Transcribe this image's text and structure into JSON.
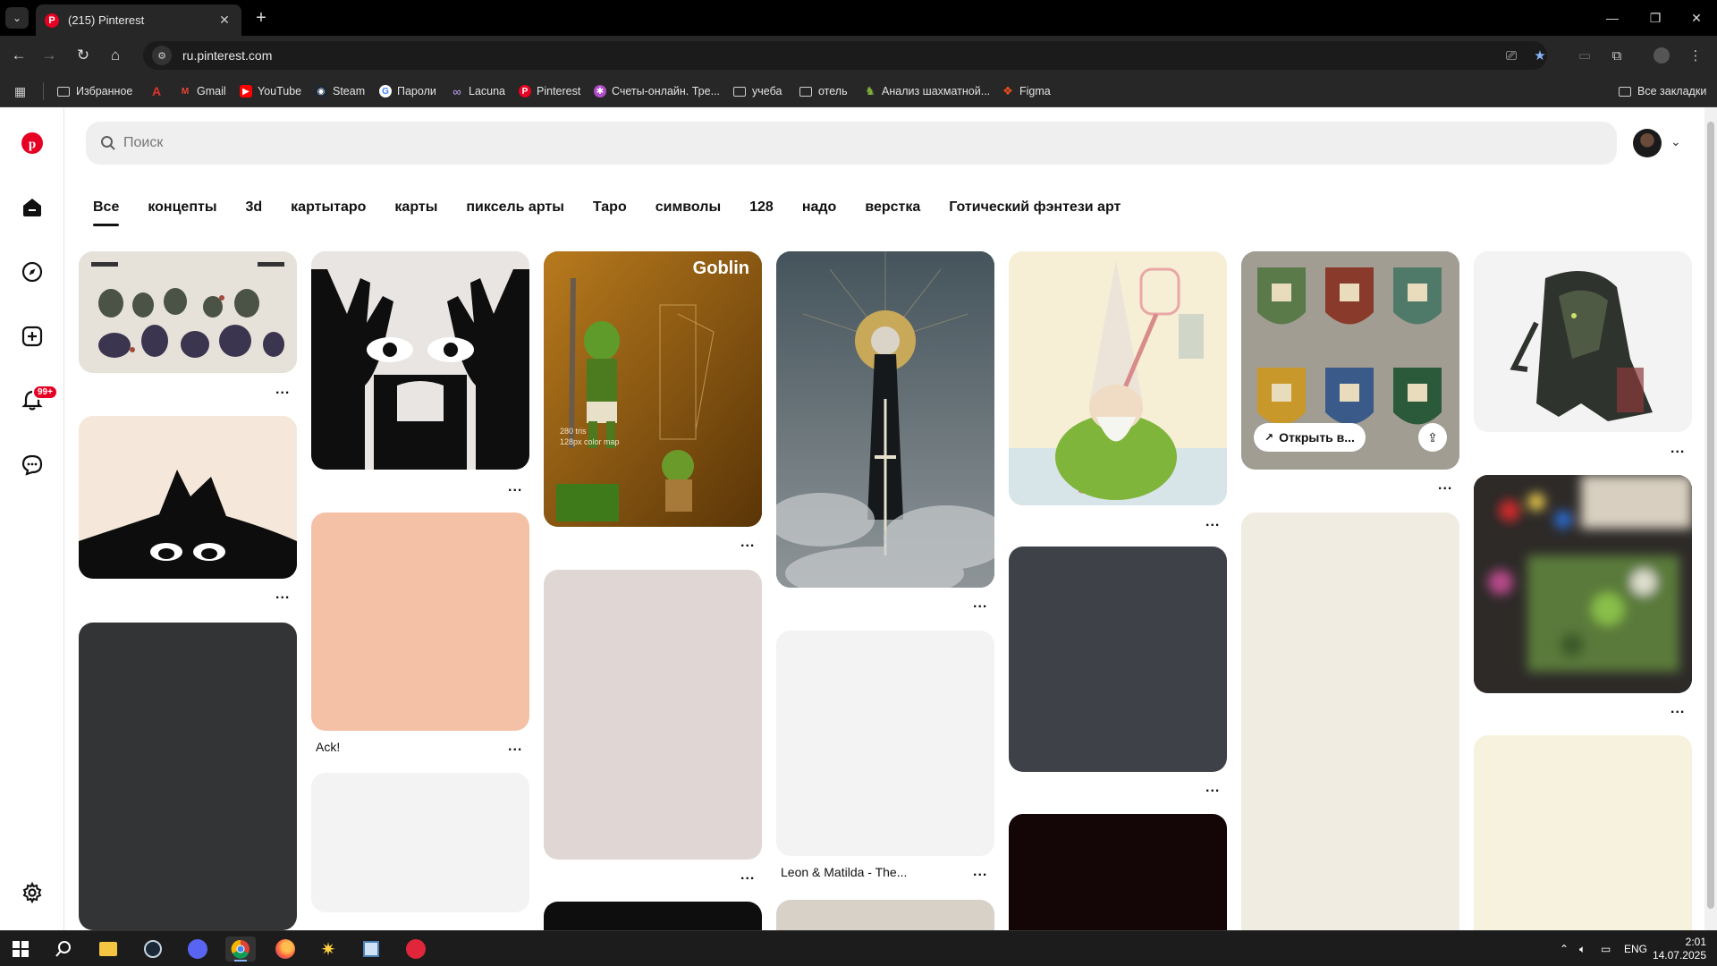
{
  "browser": {
    "tab_title": "(215) Pinterest",
    "tab_favicon": "P",
    "url": "ru.pinterest.com",
    "bookmarks": [
      {
        "label": "Избранное",
        "icon": "folder-icon"
      },
      {
        "label": "",
        "icon": "a-logo-icon"
      },
      {
        "label": "Gmail",
        "icon": "gmail-icon"
      },
      {
        "label": "YouTube",
        "icon": "youtube-icon"
      },
      {
        "label": "Steam",
        "icon": "steam-icon"
      },
      {
        "label": "Пароли",
        "icon": "google-icon"
      },
      {
        "label": "Lacuna",
        "icon": "infinity-icon"
      },
      {
        "label": "Pinterest",
        "icon": "pinterest-icon"
      },
      {
        "label": "Счеты-онлайн. Тре...",
        "icon": "app-icon"
      },
      {
        "label": "учеба",
        "icon": "folder-icon"
      },
      {
        "label": "отель",
        "icon": "folder-icon"
      },
      {
        "label": "Анализ шахматной...",
        "icon": "chess-icon"
      },
      {
        "label": "Figma",
        "icon": "figma-icon"
      },
      {
        "label": "Все закладки",
        "icon": "folder-icon"
      }
    ]
  },
  "pinterest": {
    "search_placeholder": "Поиск",
    "notification_badge": "99+",
    "board_tabs": [
      "Все",
      "концепты",
      "3d",
      "картытаро",
      "карты",
      "пиксель арты",
      "Таро",
      "символы",
      "128",
      "надо",
      "верстка",
      "Готический фэнтези арт"
    ],
    "active_tab": "Все",
    "pin_titles": {
      "ack": "Ack!",
      "leon": "Leon & Matilda - The..."
    },
    "goblin_art": {
      "title": "Goblin",
      "caption_line1": "280 tris",
      "caption_line2": "128px color map"
    },
    "open_button_label": "Открыть в...",
    "more_label": "..."
  },
  "taskbar": {
    "language": "ENG",
    "time": "2:01",
    "date": "14.07.2025"
  },
  "colors": {
    "pinterest_red": "#e60023",
    "page_bg": "#ffffff",
    "search_bg": "#efefef"
  }
}
